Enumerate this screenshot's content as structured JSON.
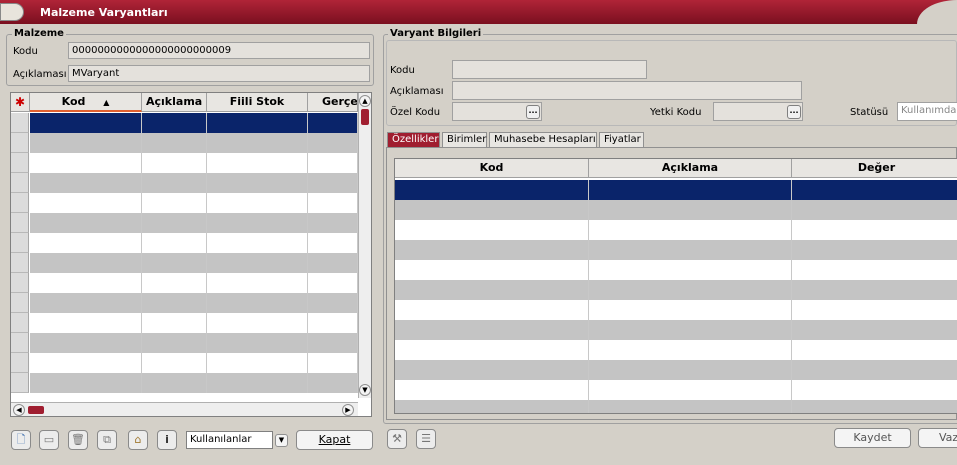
{
  "window": {
    "title": "Malzeme Varyantları"
  },
  "malzeme": {
    "title": "Malzeme",
    "kodu_label": "Kodu",
    "kodu_value": "0000000000000000000000009",
    "aciklama_label": "Açıklaması",
    "aciklama_value": "MVaryant"
  },
  "left_grid": {
    "columns": [
      "Kod",
      "Açıklama",
      "Fiili Stok",
      "Gerçe"
    ],
    "sort_indicator": "▲"
  },
  "varyant": {
    "title": "Varyant Bilgileri",
    "kodu_label": "Kodu",
    "kodu_value": "",
    "aciklama_label": "Açıklaması",
    "aciklama_value": "",
    "ozel_kodu_label": "Özel Kodu",
    "yetki_kodu_label": "Yetki Kodu",
    "statusu_label": "Statüsü",
    "statusu_value": "Kullanımda"
  },
  "tabs": [
    "Özellikler",
    "Birimler",
    "Muhasebe Hesapları",
    "Fiyatlar"
  ],
  "right_grid": {
    "columns": [
      "Kod",
      "Açıklama",
      "Değer"
    ]
  },
  "bottom": {
    "filter_value": "Kullanılanlar",
    "kapat_label": "Kapat",
    "kaydet_label": "Kaydet",
    "vazgec_label": "Vaz"
  },
  "colors": {
    "title_bar": "#a01e30",
    "selection": "#0a246a"
  }
}
